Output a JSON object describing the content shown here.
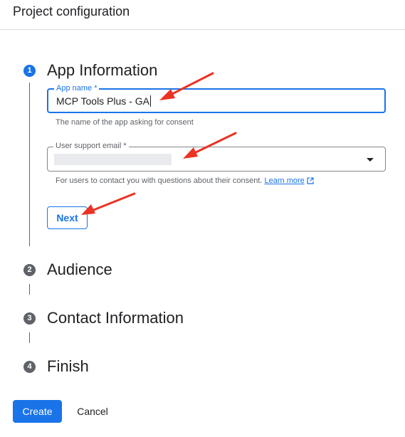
{
  "header": {
    "title": "Project configuration"
  },
  "steps": [
    {
      "number": "1",
      "title": "App Information",
      "state": "active"
    },
    {
      "number": "2",
      "title": "Audience",
      "state": "inactive"
    },
    {
      "number": "3",
      "title": "Contact Information",
      "state": "inactive"
    },
    {
      "number": "4",
      "title": "Finish",
      "state": "inactive"
    }
  ],
  "app_name": {
    "label": "App name *",
    "value": "MCP Tools Plus - GA",
    "helper": "The name of the app asking for consent"
  },
  "support_email": {
    "label": "User support email *",
    "helper": "For users to contact you with questions about their consent.",
    "learn_more": "Learn more"
  },
  "buttons": {
    "next": "Next",
    "create": "Create",
    "cancel": "Cancel"
  },
  "colors": {
    "primary": "#1a73e8",
    "inactive_step": "#5f6368",
    "annotation_arrow": "#ea3323"
  }
}
